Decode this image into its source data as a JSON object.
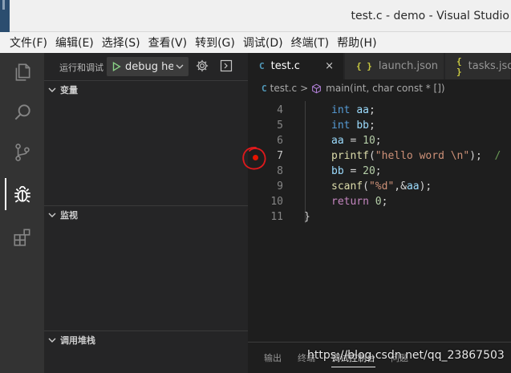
{
  "window": {
    "title": "test.c - demo - Visual Studio"
  },
  "menu": [
    "文件(F)",
    "编辑(E)",
    "选择(S)",
    "查看(V)",
    "转到(G)",
    "调试(D)",
    "终端(T)",
    "帮助(H)"
  ],
  "activity": [
    {
      "name": "explorer-icon"
    },
    {
      "name": "search-icon"
    },
    {
      "name": "source-control-icon"
    },
    {
      "name": "debug-icon",
      "active": true
    },
    {
      "name": "extensions-icon"
    }
  ],
  "debug": {
    "title": "运行和调试",
    "config": "debug he",
    "sections": [
      "变量",
      "监视",
      "调用堆栈"
    ]
  },
  "tabs": [
    {
      "icon": "C",
      "label": "test.c",
      "active": true,
      "close": "×",
      "color": "#519aba"
    },
    {
      "icon": "{ }",
      "label": "launch.json",
      "active": false,
      "color": "#cbcb41"
    },
    {
      "icon": "{ }",
      "label": "tasks.json",
      "active": false,
      "color": "#cbcb41"
    }
  ],
  "breadcrumb": {
    "lang_icon": "C",
    "file": "test.c",
    "sep": ">",
    "symbol": "main(int, char const * [])"
  },
  "code": {
    "lines": [
      {
        "n": "4",
        "tokens": [
          [
            "int",
            "kw"
          ],
          [
            " ",
            ""
          ],
          [
            "aa",
            "var"
          ],
          [
            ";",
            ""
          ]
        ]
      },
      {
        "n": "5",
        "tokens": [
          [
            "int",
            "kw"
          ],
          [
            " ",
            ""
          ],
          [
            "bb",
            "var"
          ],
          [
            ";",
            ""
          ]
        ]
      },
      {
        "n": "6",
        "tokens": [
          [
            "aa",
            "var"
          ],
          [
            " = ",
            ""
          ],
          [
            "10",
            "num"
          ],
          [
            ";",
            ""
          ]
        ]
      },
      {
        "n": "7",
        "tokens": [
          [
            "printf",
            "fn"
          ],
          [
            "(",
            ""
          ],
          [
            "\"hello word \\n\"",
            "str"
          ],
          [
            ");  ",
            ""
          ],
          [
            "/",
            "cmt"
          ]
        ],
        "current": true,
        "breakpoint": true
      },
      {
        "n": "8",
        "tokens": [
          [
            "bb",
            "var"
          ],
          [
            " = ",
            ""
          ],
          [
            "20",
            "num"
          ],
          [
            ";",
            ""
          ]
        ]
      },
      {
        "n": "9",
        "tokens": [
          [
            "scanf",
            "fn"
          ],
          [
            "(",
            ""
          ],
          [
            "\"%d\"",
            "str"
          ],
          [
            ",&",
            ""
          ],
          [
            "aa",
            "var"
          ],
          [
            ");",
            ""
          ]
        ]
      },
      {
        "n": "10",
        "tokens": [
          [
            "return",
            "ctl"
          ],
          [
            " ",
            ""
          ],
          [
            "0",
            "num"
          ],
          [
            ";",
            ""
          ]
        ]
      },
      {
        "n": "11",
        "tokens": [
          [
            "}",
            ""
          ]
        ],
        "brace": true
      }
    ]
  },
  "panel": {
    "tabs": [
      "输出",
      "终端",
      "调试控制台",
      "问题"
    ],
    "active": "调试控制台"
  },
  "watermark": "https://blog.csdn.net/qq_23867503",
  "colors": {
    "accent": "#007acc",
    "breakpoint": "#e51400",
    "annotation": "#e0191c"
  }
}
